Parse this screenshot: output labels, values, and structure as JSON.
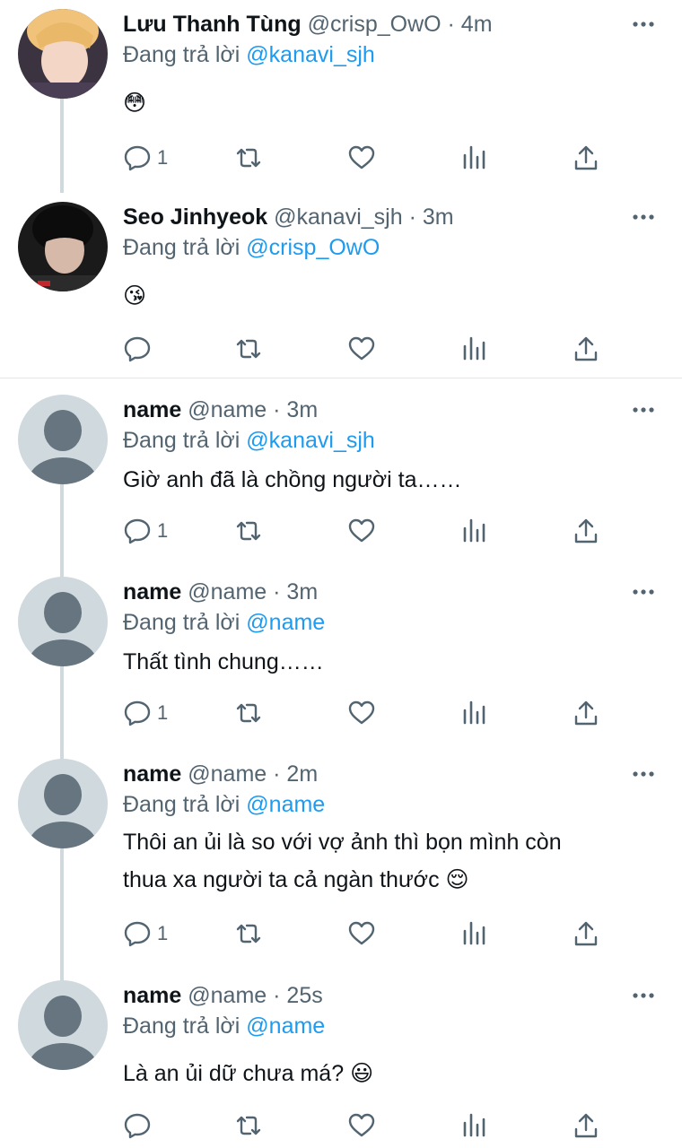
{
  "reply_prefix": "Đang trả lời",
  "tweets": [
    {
      "name": "Lưu Thanh Tùng",
      "handle": "@crisp_OwO",
      "time": "· 4m",
      "reply_to": "@kanavi_sjh",
      "lines": [
        "😳"
      ],
      "reply_count": "1"
    },
    {
      "name": "Seo Jinhyeok",
      "handle": "@kanavi_sjh",
      "time": "· 3m",
      "reply_to": "@crisp_OwO",
      "lines": [
        "😘"
      ],
      "reply_count": ""
    },
    {
      "name": "name",
      "handle": "@name",
      "time": "· 3m",
      "reply_to": "@kanavi_sjh",
      "lines": [
        "Giờ anh đã là chồng người ta……"
      ],
      "reply_count": "1"
    },
    {
      "name": "name",
      "handle": "@name",
      "time": "· 3m",
      "reply_to": "@name",
      "lines": [
        "Thất tình chung……"
      ],
      "reply_count": "1"
    },
    {
      "name": "name",
      "handle": "@name",
      "time": "· 2m",
      "reply_to": "@name",
      "lines": [
        "Thôi an ủi là so với vợ ảnh thì bọn mình còn",
        "thua xa người ta cả ngàn thước 😌"
      ],
      "reply_count": "1"
    },
    {
      "name": "name",
      "handle": "@name",
      "time": "· 25s",
      "reply_to": "@name",
      "lines": [
        "Là an ủi dữ chưa má? 😃"
      ],
      "reply_count": ""
    }
  ],
  "colors": {
    "accent": "#1d9bf0",
    "secondary_text": "#536471",
    "thread_line": "#cfd9de"
  }
}
